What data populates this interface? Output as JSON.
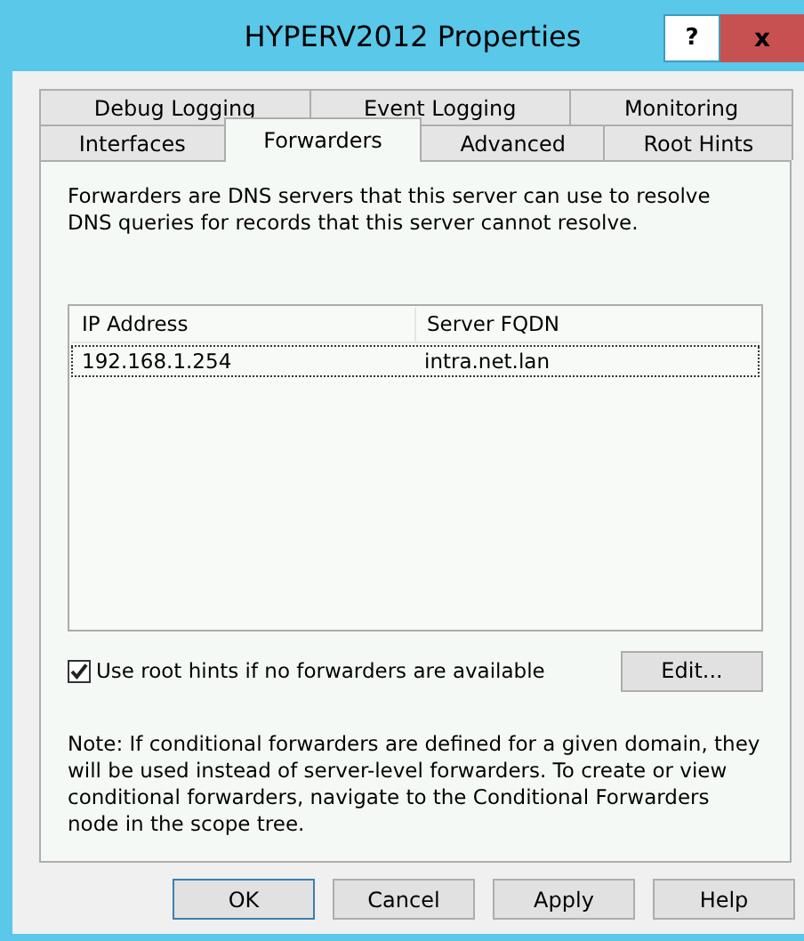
{
  "window": {
    "title": "HYPERV2012 Properties",
    "help_button": "?",
    "close_button": "x"
  },
  "tab_rows": [
    [
      {
        "label": "Debug Logging",
        "selected": false
      },
      {
        "label": "Event Logging",
        "selected": false
      },
      {
        "label": "Monitoring",
        "selected": false
      }
    ],
    [
      {
        "label": "Interfaces",
        "selected": false
      },
      {
        "label": "Forwarders",
        "selected": true
      },
      {
        "label": "Advanced",
        "selected": false
      },
      {
        "label": "Root Hints",
        "selected": false
      }
    ]
  ],
  "description": "Forwarders are DNS servers that this server can use to resolve DNS queries for records that this server cannot resolve.",
  "table": {
    "columns": [
      "IP Address",
      "Server FQDN"
    ],
    "rows": [
      {
        "cells": [
          "192.168.1.254",
          "intra.net.lan"
        ],
        "focused": true
      }
    ]
  },
  "root_hints": {
    "label": "Use root hints if no forwarders are available",
    "checked": true
  },
  "edit_button": "Edit...",
  "note": "Note: If conditional forwarders are defined for a given domain, they will be used instead of server-level forwarders.  To create or view conditional forwarders, navigate to the Conditional Forwarders node in the scope tree.",
  "buttons": [
    {
      "label": "OK",
      "default": true
    },
    {
      "label": "Cancel",
      "default": false
    },
    {
      "label": "Apply",
      "default": false
    },
    {
      "label": "Help",
      "default": false
    }
  ]
}
